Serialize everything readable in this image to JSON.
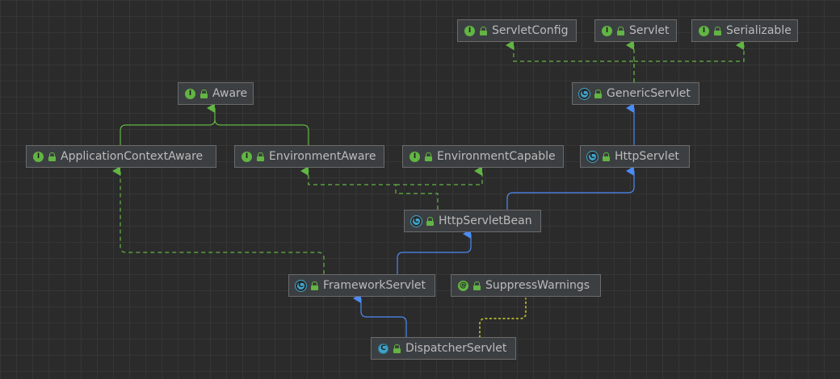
{
  "nodes": {
    "servlet_config": {
      "label": "ServletConfig",
      "kind": "interface",
      "badge": "I"
    },
    "servlet": {
      "label": "Servlet",
      "kind": "interface",
      "badge": "I"
    },
    "serializable": {
      "label": "Serializable",
      "kind": "interface",
      "badge": "I"
    },
    "generic_servlet": {
      "label": "GenericServlet",
      "kind": "abstract-class",
      "badge": "C"
    },
    "aware": {
      "label": "Aware",
      "kind": "interface",
      "badge": "I"
    },
    "application_context_aware": {
      "label": "ApplicationContextAware",
      "kind": "interface",
      "badge": "I"
    },
    "environment_aware": {
      "label": "EnvironmentAware",
      "kind": "interface",
      "badge": "I"
    },
    "environment_capable": {
      "label": "EnvironmentCapable",
      "kind": "interface",
      "badge": "I"
    },
    "http_servlet": {
      "label": "HttpServlet",
      "kind": "abstract-class",
      "badge": "C"
    },
    "http_servlet_bean": {
      "label": "HttpServletBean",
      "kind": "abstract-class",
      "badge": "C"
    },
    "framework_servlet": {
      "label": "FrameworkServlet",
      "kind": "abstract-class",
      "badge": "C"
    },
    "suppress_warnings": {
      "label": "SuppressWarnings",
      "kind": "annotation",
      "badge": "@"
    },
    "dispatcher_servlet": {
      "label": "DispatcherServlet",
      "kind": "class",
      "badge": "C"
    }
  },
  "edges": [
    {
      "from": "generic_servlet",
      "to": "servlet_config",
      "relation": "implements"
    },
    {
      "from": "generic_servlet",
      "to": "servlet",
      "relation": "implements"
    },
    {
      "from": "generic_servlet",
      "to": "serializable",
      "relation": "implements"
    },
    {
      "from": "http_servlet",
      "to": "generic_servlet",
      "relation": "extends"
    },
    {
      "from": "application_context_aware",
      "to": "aware",
      "relation": "extends-interface"
    },
    {
      "from": "environment_aware",
      "to": "aware",
      "relation": "extends-interface"
    },
    {
      "from": "http_servlet_bean",
      "to": "environment_aware",
      "relation": "implements"
    },
    {
      "from": "http_servlet_bean",
      "to": "environment_capable",
      "relation": "implements"
    },
    {
      "from": "http_servlet_bean",
      "to": "http_servlet",
      "relation": "extends"
    },
    {
      "from": "framework_servlet",
      "to": "http_servlet_bean",
      "relation": "extends"
    },
    {
      "from": "framework_servlet",
      "to": "application_context_aware",
      "relation": "implements"
    },
    {
      "from": "dispatcher_servlet",
      "to": "framework_servlet",
      "relation": "extends"
    },
    {
      "from": "dispatcher_servlet",
      "to": "suppress_warnings",
      "relation": "annotated-with"
    }
  ],
  "colors": {
    "extends": "#4c8bf5",
    "implements": "#62b543",
    "annotation_link": "#a6a62e",
    "node_bg": "#3c3f41",
    "node_border": "#6b6b6b",
    "text": "#bbbbbb"
  }
}
